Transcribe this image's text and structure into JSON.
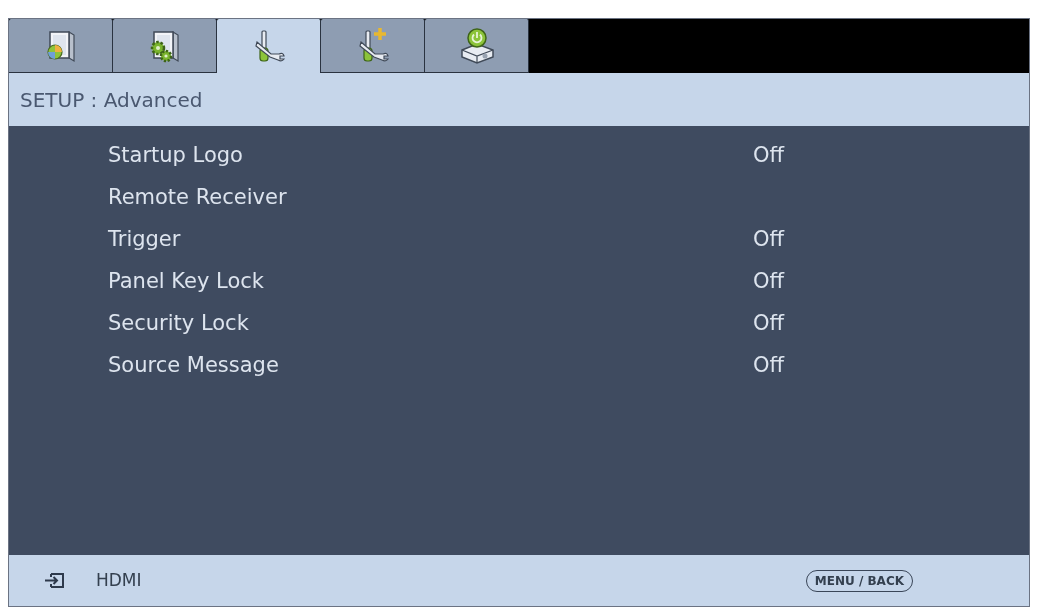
{
  "tabs": [
    {
      "selected": false
    },
    {
      "selected": false
    },
    {
      "selected": true
    },
    {
      "selected": false
    },
    {
      "selected": false
    }
  ],
  "header": {
    "title": "SETUP : Advanced"
  },
  "menu": {
    "rows": [
      {
        "label": "Startup Logo",
        "value": "Off"
      },
      {
        "label": "Remote Receiver"
      },
      {
        "label": "Trigger",
        "value": "Off"
      },
      {
        "label": "Panel Key Lock",
        "value": "Off"
      },
      {
        "label": "Security Lock",
        "value": "Off"
      },
      {
        "label": "Source Message",
        "value": "Off"
      }
    ]
  },
  "status_bar": {
    "source": "HDMI",
    "back_key": "MENU / BACK"
  }
}
